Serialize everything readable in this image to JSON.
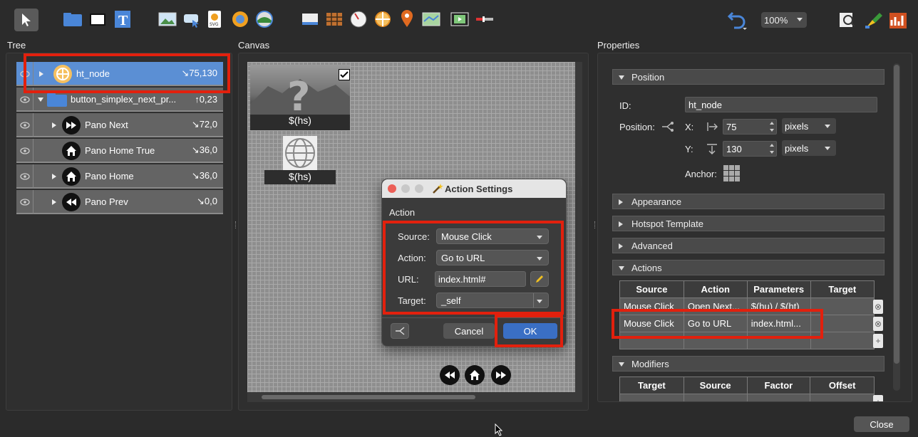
{
  "toolbar": {
    "zoom": "100%",
    "icons": [
      "select-arrow-icon",
      "folder-icon",
      "rectangle-icon",
      "text-icon",
      "image-icon",
      "cloud-icon",
      "svg-icon",
      "globe-icon",
      "pano-icon",
      "window-icon",
      "grid-icon",
      "compass-icon",
      "crosshair-icon",
      "pin-icon",
      "map-icon",
      "video-icon",
      "slider-icon",
      "undo-icon",
      "search-icon",
      "paint-icon",
      "chart-icon"
    ]
  },
  "panels": {
    "tree": "Tree",
    "canvas": "Canvas",
    "properties": "Properties"
  },
  "tree": {
    "rows": [
      {
        "label": "ht_node",
        "value": "↘75,130",
        "icon": "crosshair-icon",
        "selected": true
      },
      {
        "label": "button_simplex_next_pr...",
        "value": "↑0,23",
        "icon": "folder-icon"
      },
      {
        "label": "Pano Next",
        "value": "↘72,0",
        "icon": "fast-forward-icon"
      },
      {
        "label": "Pano Home True",
        "value": "↘36,0",
        "icon": "home-icon"
      },
      {
        "label": "Pano Home",
        "value": "↘36,0",
        "icon": "home-icon"
      },
      {
        "label": "Pano Prev",
        "value": "↘0,0",
        "icon": "rewind-icon"
      }
    ]
  },
  "canvas": {
    "hs1_label": "$(hs)",
    "hs2_label": "$(hs)"
  },
  "dialog": {
    "title": "Action Settings",
    "section": "Action",
    "source_label": "Source:",
    "source_value": "Mouse Click",
    "action_label": "Action:",
    "action_value": "Go to URL",
    "url_label": "URL:",
    "url_value": "index.html#",
    "target_label": "Target:",
    "target_value": "_self",
    "cancel": "Cancel",
    "ok": "OK"
  },
  "properties": {
    "position_section": "Position",
    "id_label": "ID:",
    "id_value": "ht_node",
    "position_label": "Position:",
    "x_label": "X:",
    "x_value": "75",
    "x_unit": "pixels",
    "y_label": "Y:",
    "y_value": "130",
    "y_unit": "pixels",
    "anchor_label": "Anchor:",
    "appearance": "Appearance",
    "hotspot_template": "Hotspot Template",
    "advanced": "Advanced",
    "actions": "Actions",
    "actions_table": {
      "headers": [
        "Source",
        "Action",
        "Parameters",
        "Target"
      ],
      "rows": [
        [
          "Mouse Click",
          "Open Next...",
          "$(hu) / $(ht)",
          ""
        ],
        [
          "Mouse Click",
          "Go to URL",
          "index.html...",
          ""
        ]
      ]
    },
    "modifiers": "Modifiers",
    "modifiers_table": {
      "headers": [
        "Target",
        "Source",
        "Factor",
        "Offset"
      ]
    }
  },
  "footer": {
    "close": "Close"
  },
  "colors": {
    "selected_row": "#5b8fd4",
    "highlight": "#e2200d",
    "ok_button": "#3a6fc4"
  }
}
